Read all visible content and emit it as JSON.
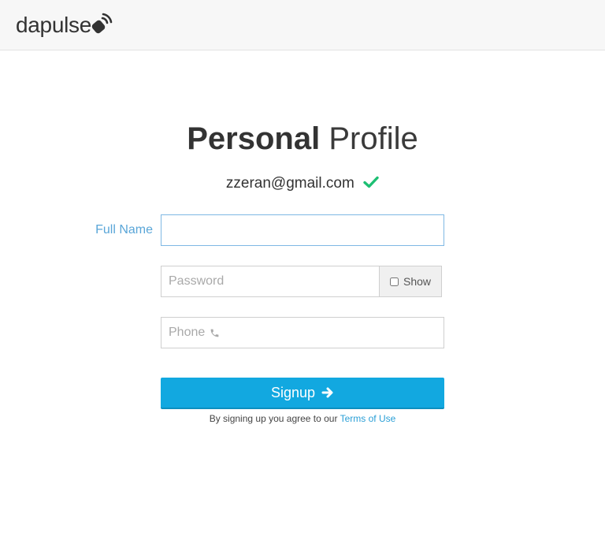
{
  "brand": {
    "name": "dapulse"
  },
  "page": {
    "title_bold": "Personal",
    "title_light": "Profile",
    "email": "zzeran@gmail.com"
  },
  "form": {
    "full_name_label": "Full Name",
    "full_name_value": "",
    "password_placeholder": "Password",
    "show_label": "Show",
    "phone_placeholder": "Phone",
    "signup_label": "Signup",
    "terms_text": "By signing up you agree to our",
    "terms_link": "Terms of Use"
  },
  "icons": {
    "logo": "dapulse-logo-icon",
    "email_verified": "check-icon",
    "phone": "phone-icon",
    "signup": "arrow-right-icon"
  },
  "colors": {
    "accent": "#12a8e0",
    "label": "#5aa6d8",
    "check": "#1dbf73",
    "link": "#2a9fd6"
  }
}
